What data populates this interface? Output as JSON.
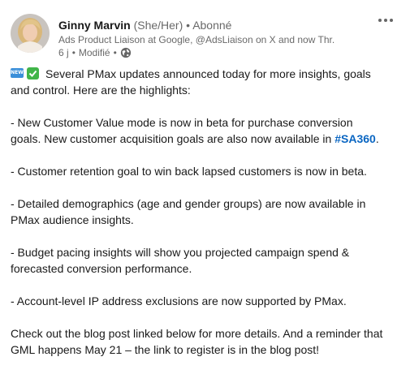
{
  "actor": {
    "name": "Ginny Marvin",
    "pronouns": "(She/Her)",
    "follow_status": "Abonné",
    "description": "Ads Product Liaison at Google, @AdsLiaison on X and now Thr...",
    "time": "6 j",
    "edited": "Modifié",
    "visibility_icon": "globe-icon"
  },
  "menu": {
    "icon": "more-horizontal-icon"
  },
  "post": {
    "emoji_new_label": "NEW",
    "intro": "Several PMax updates announced today for more insights, goals and control. Here are the highlights:",
    "p1_a": "- New Customer Value mode is now in beta for purchase conversion goals. New customer acquisition goals are also now available in ",
    "p1_hashtag": "#SA360",
    "p1_b": ".",
    "p2": "- Customer retention goal to win back lapsed customers is now in beta.",
    "p3": "- Detailed demographics (age and gender groups) are now available in PMax audience insights.",
    "p4": "- Budget pacing insights will show you projected campaign spend & forecasted conversion performance.",
    "p5": "- Account-level IP address exclusions are now supported by PMax.",
    "p6": "Check out the blog post linked below for more details. And a reminder that GML happens May 21 – the link to register is in the blog post!"
  },
  "colors": {
    "link": "#0a66c2",
    "emoji_new_bg": "#3b8fd9",
    "emoji_check_bg": "#41b549"
  }
}
